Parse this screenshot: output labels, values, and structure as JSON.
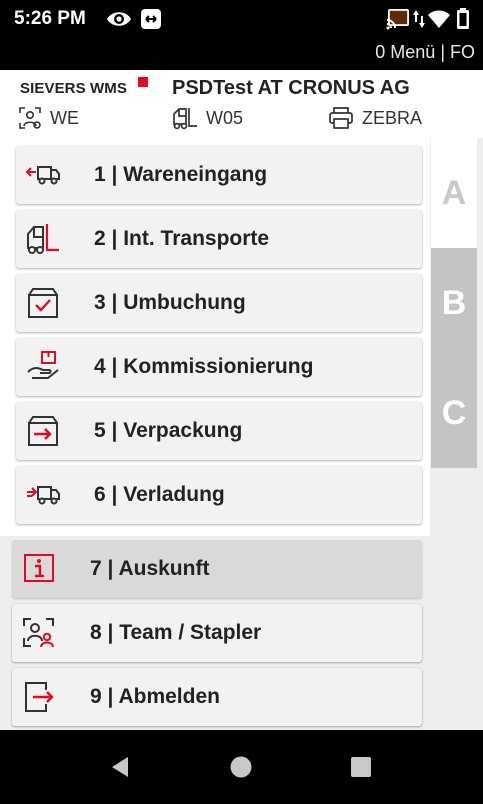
{
  "status_bar": {
    "time": "5:26 PM",
    "icons": [
      "eye-icon",
      "link-icon",
      "cast-icon",
      "data-arrows-icon",
      "wifi-icon",
      "battery-icon"
    ]
  },
  "app_bar": {
    "menu_text": "0 Menü | FO"
  },
  "header": {
    "logo_text": "SIEVERS WMS",
    "title": "PSDTest AT CRONUS AG",
    "info": [
      {
        "icon": "user-location-icon",
        "label": "WE"
      },
      {
        "icon": "forklift-icon",
        "label": "W05"
      },
      {
        "icon": "printer-icon",
        "label": "ZEBRA"
      }
    ]
  },
  "tabs": [
    "A",
    "B",
    "C"
  ],
  "menu": [
    {
      "icon": "truck-incoming-icon",
      "label": "1 | Wareneingang"
    },
    {
      "icon": "forklift-icon",
      "label": "2 | Int. Transporte"
    },
    {
      "icon": "box-check-icon",
      "label": "3 | Umbuchung"
    },
    {
      "icon": "hand-package-icon",
      "label": "4 | Kommissionierung"
    },
    {
      "icon": "box-arrow-icon",
      "label": "5 | Verpackung"
    },
    {
      "icon": "truck-outgoing-icon",
      "label": "6 | Verladung"
    },
    {
      "icon": "info-icon",
      "label": "7 | Auskunft"
    },
    {
      "icon": "team-icon",
      "label": "8 | Team / Stapler"
    },
    {
      "icon": "logout-icon",
      "label": "9 | Abmelden"
    }
  ],
  "nav_bar": [
    "back-icon",
    "home-icon",
    "recents-icon"
  ],
  "colors": {
    "accent": "#e10a1e",
    "tab_active": "#ffffff",
    "tab_inactive": "#c4c4c4",
    "item_background": "#f2f2f2",
    "item_selected": "#d9d9d9"
  }
}
